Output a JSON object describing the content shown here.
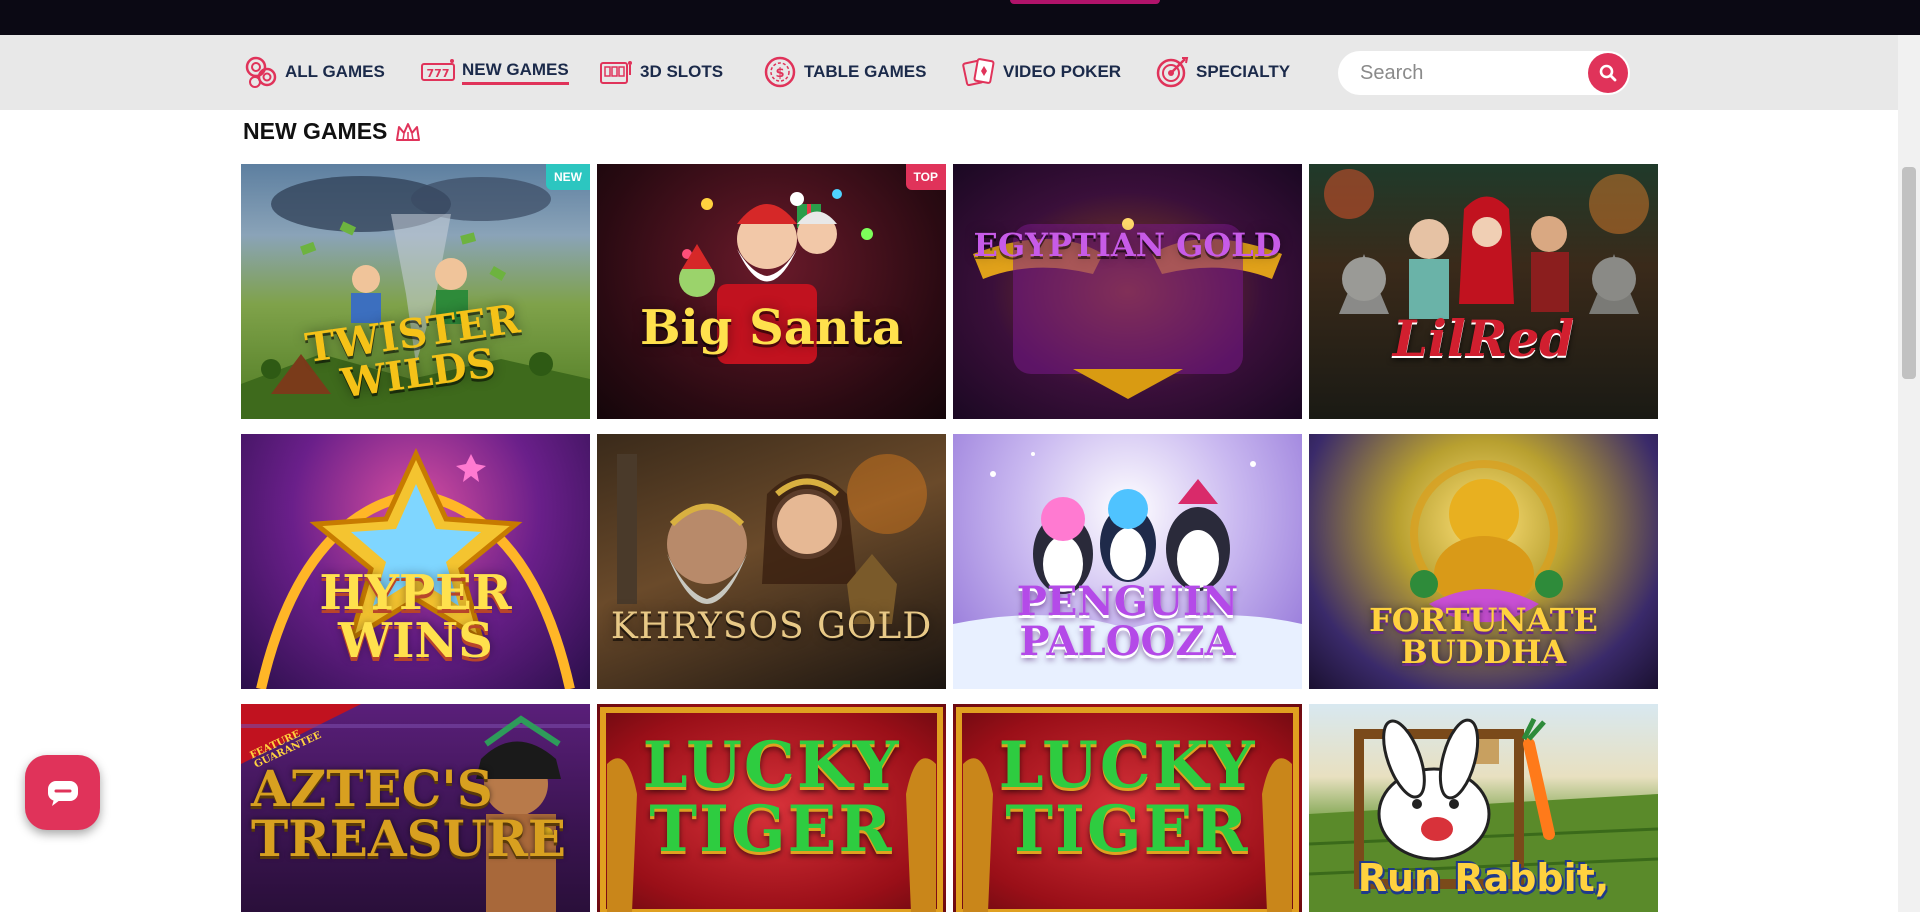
{
  "nav": {
    "items": [
      {
        "label": "ALL GAMES",
        "icon": "chips-icon",
        "active": false
      },
      {
        "label": "NEW GAMES",
        "icon": "slot-777-icon",
        "active": true
      },
      {
        "label": "3D SLOTS",
        "icon": "slot-machine-icon",
        "active": false
      },
      {
        "label": "TABLE GAMES",
        "icon": "dollar-chip-icon",
        "active": false
      },
      {
        "label": "VIDEO POKER",
        "icon": "playing-cards-icon",
        "active": false
      },
      {
        "label": "SPECIALTY",
        "icon": "target-icon",
        "active": false
      }
    ],
    "search": {
      "placeholder": "Search",
      "icon": "search-icon"
    }
  },
  "section": {
    "title": "NEW GAMES",
    "icon": "crown-icon"
  },
  "games": [
    {
      "name": "TWISTER WILDS",
      "badge": "NEW"
    },
    {
      "name": "Big Santa",
      "badge": "TOP"
    },
    {
      "name": "EGYPTIAN GOLD",
      "badge": ""
    },
    {
      "name": "LilRed",
      "badge": ""
    },
    {
      "name": "HYPER WINS",
      "badge": ""
    },
    {
      "name": "KHRYSOS GOLD",
      "badge": ""
    },
    {
      "name": "PENGUIN PALOOZA",
      "badge": ""
    },
    {
      "name": "FORTUNATE BUDDHA",
      "badge": ""
    },
    {
      "name": "AZTEC'S TREASURE",
      "badge": "",
      "ribbon": "FEATURE GUARANTEE"
    },
    {
      "name": "LUCKY TIGER",
      "badge": ""
    },
    {
      "name": "LUCKY TIGER",
      "badge": ""
    },
    {
      "name": "Run Rabbit,",
      "badge": ""
    }
  ],
  "colors": {
    "accent": "#e0335a",
    "nav_text": "#1b2a4a",
    "nav_bg": "#e8e8e8",
    "new_badge": "#2cc6c0"
  },
  "chat": {
    "icon": "chat-bubble-icon"
  }
}
